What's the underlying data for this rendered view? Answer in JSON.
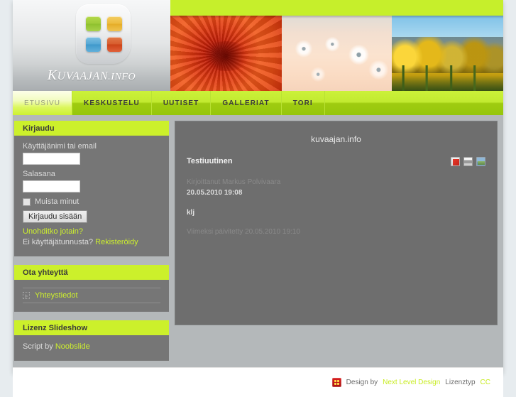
{
  "site": {
    "logo_text_cap": "K",
    "logo_text_rest": "UVAAJAN",
    "logo_text_suffix": ".INFO",
    "logo_squares": [
      "green-square",
      "orange-square",
      "blue-square",
      "red-square"
    ]
  },
  "banner": {
    "images": [
      {
        "name": "red-chrysanthemum-photo"
      },
      {
        "name": "pale-daisies-photo"
      },
      {
        "name": "yellow-tulips-photo"
      }
    ]
  },
  "nav": {
    "items": [
      {
        "label": "ETUSIVU",
        "active": true
      },
      {
        "label": "KESKUSTELU",
        "active": false
      },
      {
        "label": "UUTISET",
        "active": false
      },
      {
        "label": "GALLERIAT",
        "active": false
      },
      {
        "label": "TORI",
        "active": false
      }
    ]
  },
  "sidebar": {
    "login": {
      "title": "Kirjaudu",
      "username_label": "Käyttäjänimi tai email",
      "username_value": "",
      "password_label": "Salasana",
      "password_value": "",
      "remember_label": "Muista minut",
      "submit_label": "Kirjaudu sisään",
      "forgot_link": "Unohditko jotain?",
      "register_prefix": "Ei käyttäjätunnusta?",
      "register_link": "Rekisteröidy"
    },
    "contact": {
      "title": "Ota yhteyttä",
      "items": [
        {
          "label": "Yhteystiedot",
          "icon": "arrow-bullet-icon"
        }
      ]
    },
    "slideshow": {
      "title": "Lizenz Slideshow",
      "credit_prefix": "Script by",
      "credit_link": "Noobslide"
    }
  },
  "main": {
    "site_heading": "kuvaajan.info",
    "article": {
      "title": "Testiuutinen",
      "author": "Kirjoittanut Markus Polvivaara",
      "date": "20.05.2010 19:08",
      "body": "klj",
      "updated": "Viimeksi päivitetty 20.05.2010 19:10",
      "tools": [
        {
          "name": "pdf-icon"
        },
        {
          "name": "print-icon"
        },
        {
          "name": "email-icon"
        }
      ]
    }
  },
  "footer": {
    "design_prefix": "Design by",
    "design_link": "Next Level Design",
    "license_label": "Lizenztyp",
    "license_link": "CC"
  },
  "colors": {
    "accent_green": "#ccf02b",
    "nav_green_top": "#cbf139",
    "nav_green_bottom": "#96c60c",
    "link_green": "#cdef2e",
    "sidebar_bg": "#767676",
    "content_bg": "#6e6e6e",
    "page_bg": "#b4b8ba"
  }
}
